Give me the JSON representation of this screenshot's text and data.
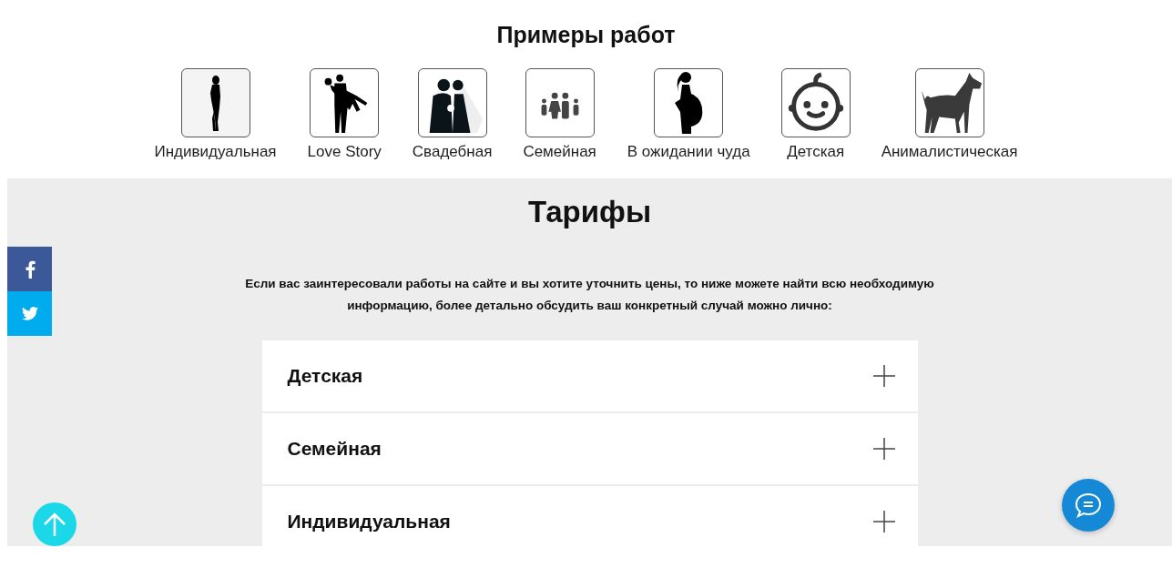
{
  "works": {
    "title": "Примеры работ",
    "items": [
      {
        "label": "Индивидуальная",
        "kind": "woman"
      },
      {
        "label": "Love Story",
        "kind": "couple"
      },
      {
        "label": "Свадебная",
        "kind": "wedding"
      },
      {
        "label": "Семейная",
        "kind": "family"
      },
      {
        "label": "В ожидании чуда",
        "kind": "pregnant"
      },
      {
        "label": "Детская",
        "kind": "baby"
      },
      {
        "label": "Анималистическая",
        "kind": "dog"
      }
    ]
  },
  "pricing": {
    "title": "Тарифы",
    "intro": "Если вас заинтересовали работы на сайте и вы хотите уточнить цены, то ниже можете найти всю необходимую информацию, более детально обсудить ваш конкретный случай можно лично:",
    "items": [
      {
        "title": "Детская",
        "expanded": false
      },
      {
        "title": "Семейная",
        "expanded": false
      },
      {
        "title": "Индивидуальная",
        "expanded": false
      }
    ]
  },
  "share": [
    {
      "kind": "facebook"
    },
    {
      "kind": "twitter"
    }
  ]
}
